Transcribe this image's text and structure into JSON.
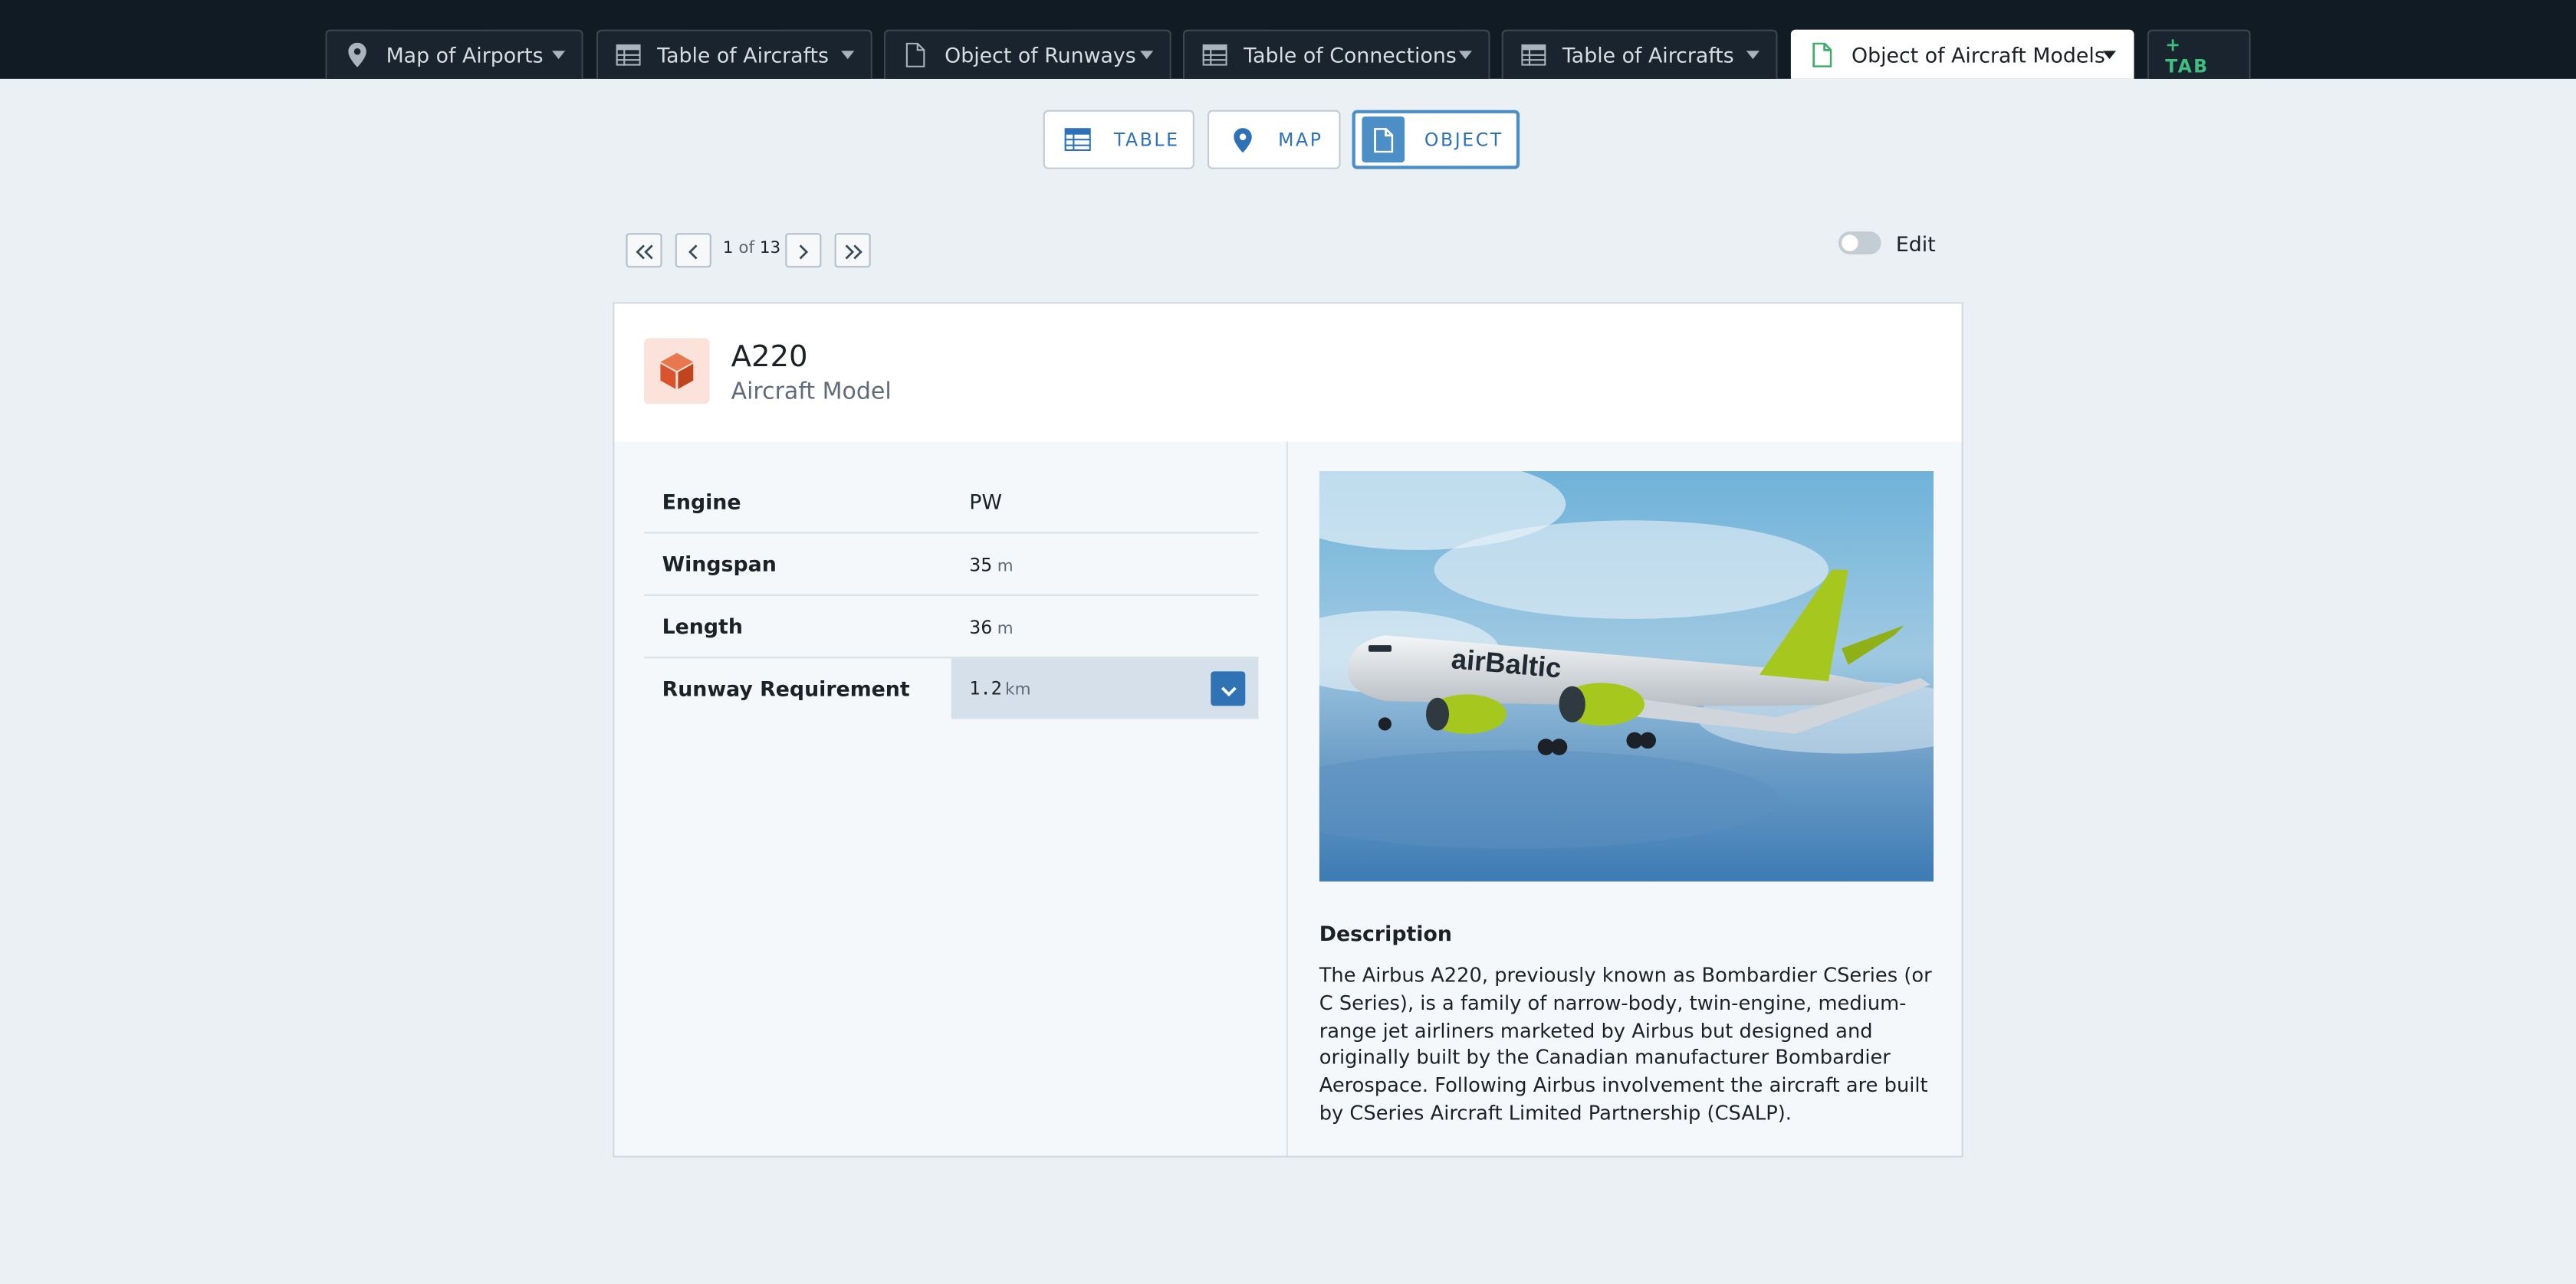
{
  "tabs": [
    {
      "label": "Map of Airports",
      "icon": "map-pin-icon"
    },
    {
      "label": "Table of Aircrafts",
      "icon": "table-icon"
    },
    {
      "label": "Object of Runways",
      "icon": "document-icon"
    },
    {
      "label": "Table of Connections",
      "icon": "table-icon"
    },
    {
      "label": "Table of Aircrafts",
      "icon": "table-icon"
    },
    {
      "label": "Object of Aircraft Models",
      "icon": "document-icon",
      "active": true
    }
  ],
  "add_tab_label": "+ TAB",
  "views": [
    {
      "label": "TABLE",
      "icon": "table-icon"
    },
    {
      "label": "MAP",
      "icon": "map-pin-icon"
    },
    {
      "label": "OBJECT",
      "icon": "document-icon",
      "active": true
    }
  ],
  "pager": {
    "current": "1",
    "of": "of",
    "total": "13"
  },
  "edit_label": "Edit",
  "edit_enabled": false,
  "object": {
    "title": "A220",
    "subtitle": "Aircraft Model",
    "icon": "cube-icon",
    "properties": [
      {
        "key": "Engine",
        "value": "PW",
        "unit": ""
      },
      {
        "key": "Wingspan",
        "value": "35",
        "unit": "m"
      },
      {
        "key": "Length",
        "value": "36",
        "unit": "m"
      },
      {
        "key": "Runway Requirement",
        "value": "1.2",
        "unit": "km"
      }
    ],
    "image_alt": "airBaltic Airbus A220 in flight",
    "image_text": "airBaltic",
    "description_title": "Description",
    "description": "The Airbus A220, previously known as Bombardier CSeries (or C Series), is a family of narrow-body, twin-engine, medium-range jet airliners marketed by Airbus but designed and originally built by the Canadian manufacturer Bombardier Aerospace. Following Airbus involvement the aircraft are built by CSeries Aircraft Limited Partnership (CSALP)."
  },
  "colors": {
    "topbar": "#111b24",
    "accent": "#2d72b8",
    "object_icon": "#d9542c",
    "livery_green": "#a6c81e"
  }
}
